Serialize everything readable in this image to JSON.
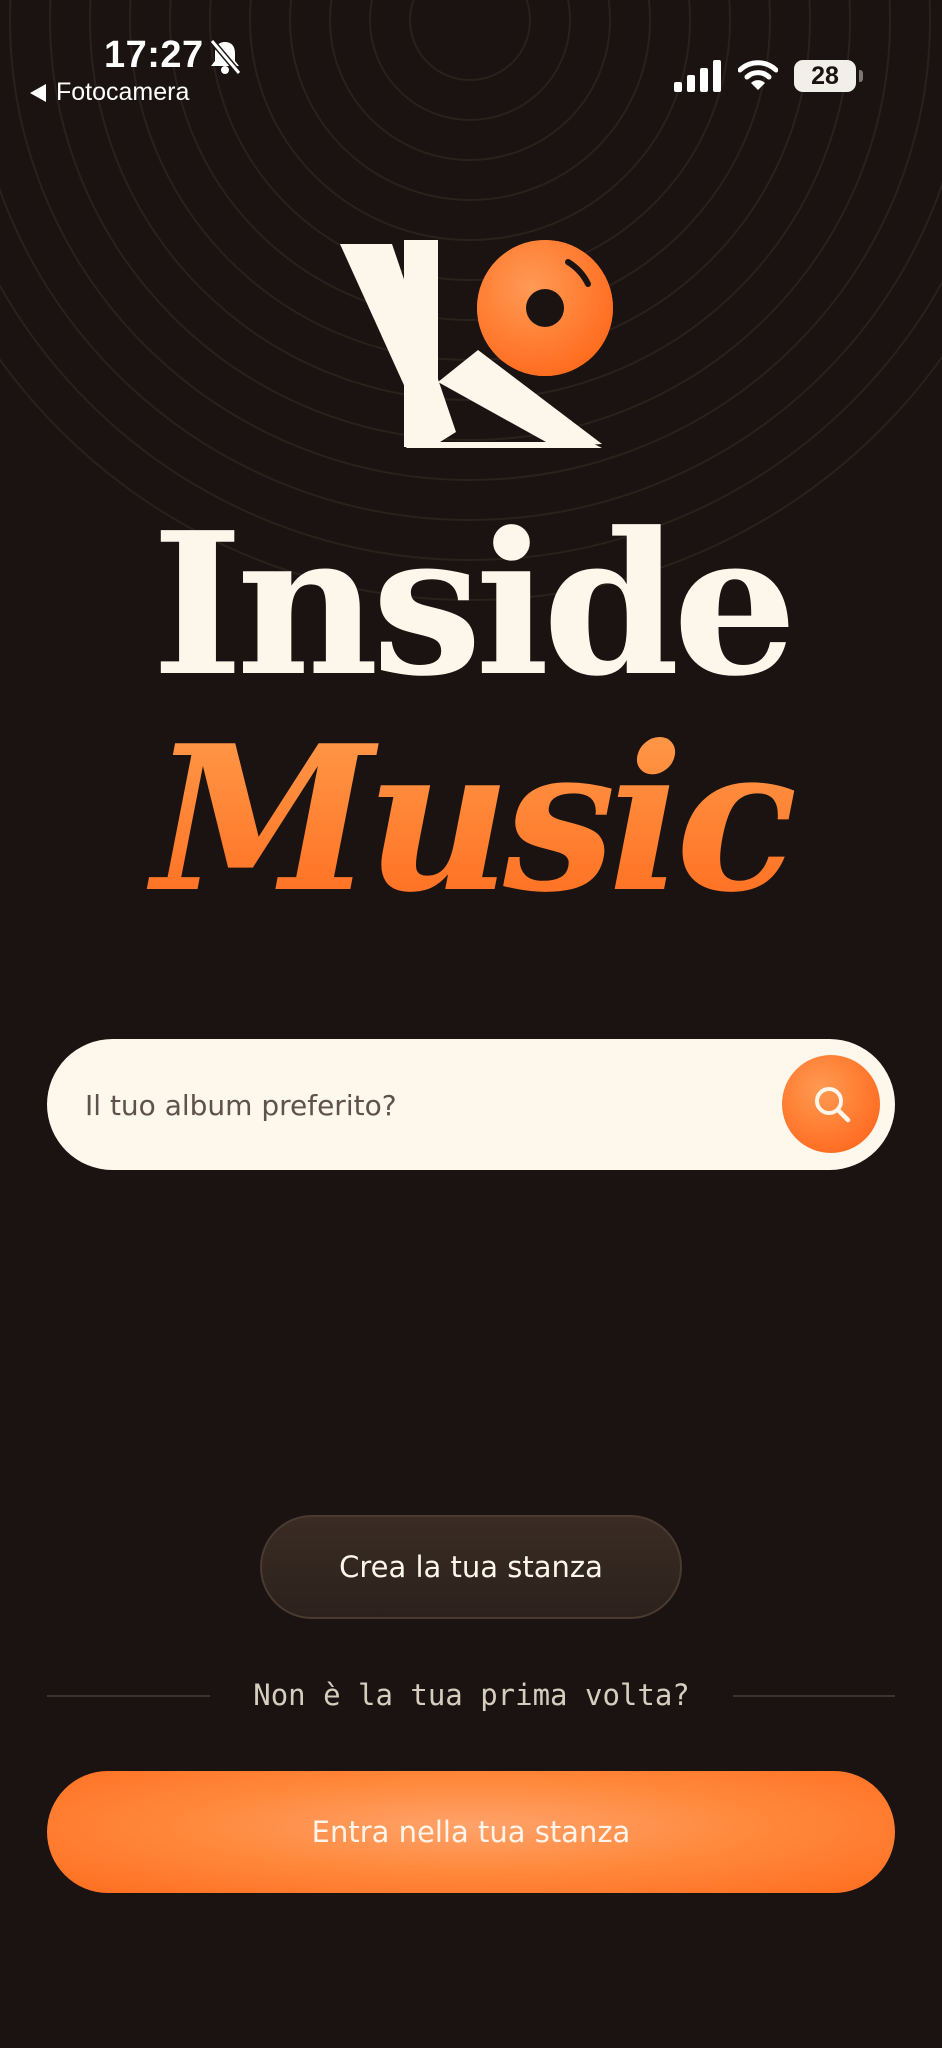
{
  "status_bar": {
    "time": "17:27",
    "back_label": "Fotocamera",
    "battery": "28",
    "icons": [
      "bell-muted-icon",
      "signal-icon",
      "wifi-icon",
      "battery-icon",
      "back-arrow-icon"
    ]
  },
  "hero": {
    "logo_icon": "vinyl-record-logo-icon",
    "title_line1": "Inside",
    "title_line2": "Music"
  },
  "search": {
    "placeholder": "Il tuo album preferito?",
    "value": "",
    "button_icon": "search-icon"
  },
  "actions": {
    "create_room_label": "Crea la tua stanza",
    "divider_text": "Non è la tua prima volta?",
    "enter_room_label": "Entra nella tua stanza"
  },
  "colors": {
    "background": "#1b1311",
    "accent": "#ff7a2a",
    "cream": "#fdf6ea"
  }
}
